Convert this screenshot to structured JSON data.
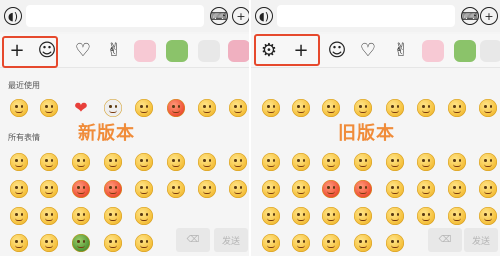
{
  "panels": {
    "left": {
      "caption": "新版本",
      "recent_title": "最近使用",
      "all_title": "所有表情",
      "icons": {
        "voice": "voice-icon",
        "keyboard": "keyboard-icon",
        "add": "plus-icon",
        "add_tab": "plus-icon",
        "emoji_tab": "smiley-icon",
        "like_tab": "heart-icon",
        "gesture_tab": "victory-hand-icon"
      },
      "send_label": "发送",
      "delete_label": "⌫"
    },
    "right": {
      "caption": "旧版本",
      "icons": {
        "voice": "voice-icon",
        "keyboard": "keyboard-icon",
        "add": "plus-icon",
        "settings_tab": "gear-icon",
        "add_tab": "plus-icon",
        "emoji_tab": "smiley-icon",
        "like_tab": "heart-icon",
        "gesture_tab": "victory-hand-icon"
      },
      "delete_label": "⌫",
      "send_label": "发送"
    }
  },
  "glyphs": {
    "voice": "◖)",
    "keyboard": "⌨",
    "plus": "+",
    "smiley": "☺",
    "heart": "♡",
    "victory": "✌",
    "gear": "⚙",
    "heart_solid": "❤"
  },
  "colors": {
    "highlight": "#e6492d",
    "caption": "#f08c3a"
  }
}
